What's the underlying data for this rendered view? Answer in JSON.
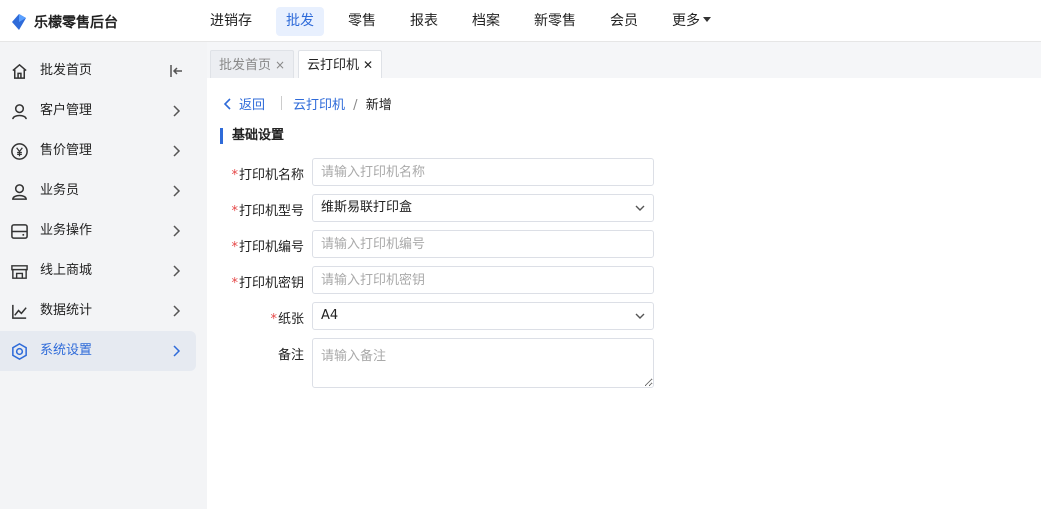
{
  "app": {
    "title": "乐檬零售后台"
  },
  "topnav": [
    {
      "label": "进销存",
      "active": false
    },
    {
      "label": "批发",
      "active": true
    },
    {
      "label": "零售",
      "active": false
    },
    {
      "label": "报表",
      "active": false
    },
    {
      "label": "档案",
      "active": false
    },
    {
      "label": "新零售",
      "active": false
    },
    {
      "label": "会员",
      "active": false
    },
    {
      "label": "更多",
      "active": false,
      "dropdown": true
    }
  ],
  "sidebar": {
    "items": [
      {
        "label": "批发首页",
        "icon": "home-icon"
      },
      {
        "label": "客户管理",
        "icon": "user-icon"
      },
      {
        "label": "售价管理",
        "icon": "yen-icon"
      },
      {
        "label": "业务员",
        "icon": "person-icon"
      },
      {
        "label": "业务操作",
        "icon": "server-icon"
      },
      {
        "label": "线上商城",
        "icon": "store-icon"
      },
      {
        "label": "数据统计",
        "icon": "chart-icon"
      },
      {
        "label": "系统设置",
        "icon": "settings-icon",
        "active": true
      }
    ]
  },
  "tabs": [
    {
      "label": "批发首页",
      "close": "×",
      "active": false
    },
    {
      "label": "云打印机",
      "close": "✕",
      "active": true
    }
  ],
  "breadcrumb": {
    "back": "返回",
    "parent": "云打印机",
    "separator": "/",
    "current": "新增"
  },
  "section": {
    "title": "基础设置"
  },
  "form": {
    "name": {
      "label": "打印机名称",
      "required": "*",
      "placeholder": "请输入打印机名称"
    },
    "model": {
      "label": "打印机型号",
      "required": "*",
      "value": "维斯易联打印盒"
    },
    "serial": {
      "label": "打印机编号",
      "required": "*",
      "placeholder": "请输入打印机编号"
    },
    "key": {
      "label": "打印机密钥",
      "required": "*",
      "placeholder": "请输入打印机密钥"
    },
    "paper": {
      "label": "纸张",
      "required": "*",
      "value": "A4"
    },
    "note": {
      "label": "备注",
      "placeholder": "请输入备注"
    }
  },
  "colors": {
    "accent": "#2f6bd9",
    "required": "#e54545"
  }
}
